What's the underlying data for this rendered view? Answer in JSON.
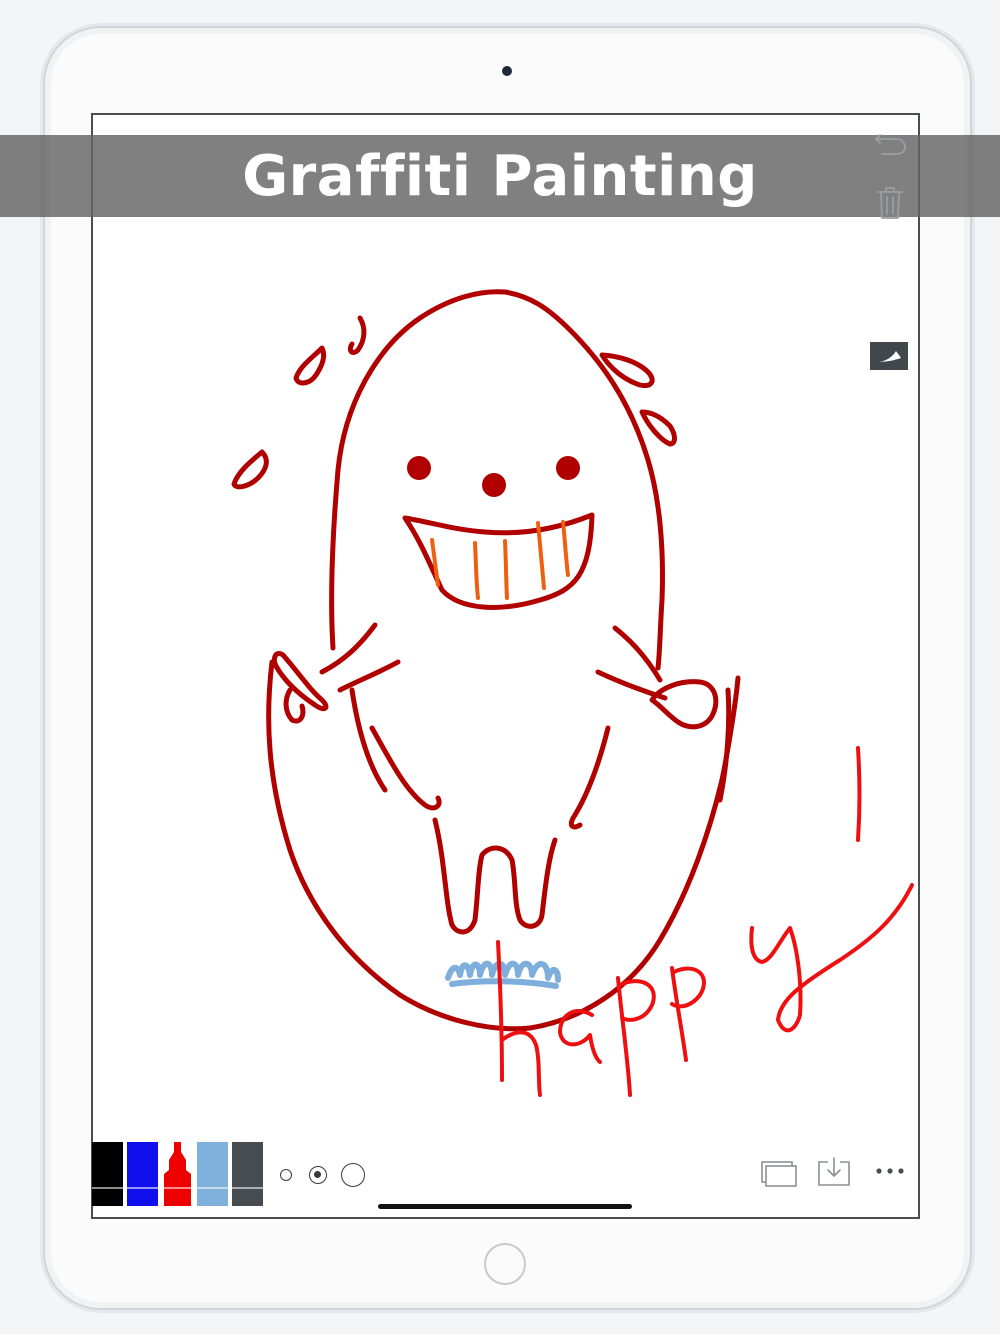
{
  "banner": {
    "title": "Graffiti Painting"
  },
  "colors": {
    "brand_red": "#b00000",
    "bright_red": "#ee1010",
    "teeth_orange": "#ee6010",
    "scribble_blue": "#7eaedc",
    "palette": [
      {
        "name": "black-marker",
        "color": "#000000"
      },
      {
        "name": "blue-marker",
        "color": "#1010ee"
      },
      {
        "name": "red-marker",
        "color": "#ee0000"
      },
      {
        "name": "lightblue-marker",
        "color": "#7eb2dc"
      },
      {
        "name": "gray-marker",
        "color": "#464c50"
      }
    ]
  },
  "brush_sizes": [
    "small",
    "medium",
    "large"
  ],
  "selected_brush_size": "medium",
  "toolbar": {
    "undo_icon": "undo-icon",
    "trash_icon": "trash-icon",
    "ruler_icon": "ruler-icon",
    "layers_icon": "layers-icon",
    "save_icon": "save-icon",
    "more_icon": "more-icon"
  },
  "canvas": {
    "drawn_text": "happy!"
  }
}
